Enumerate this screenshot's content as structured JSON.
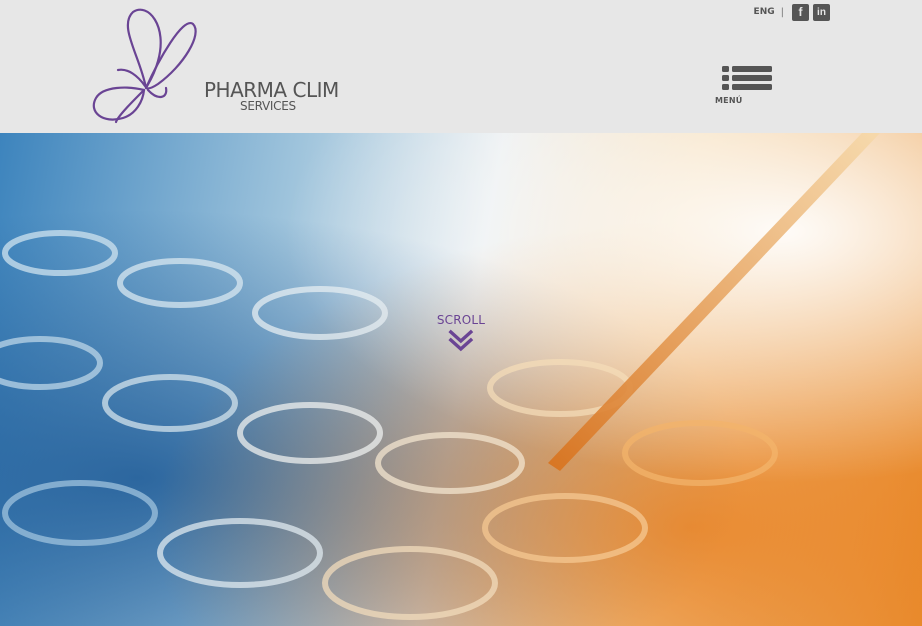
{
  "header": {
    "brand_name": "PHARMA CLIM",
    "brand_sub": "SERVICES",
    "language": "ENG",
    "separator": "|",
    "social": {
      "facebook": "f",
      "linkedin": "in"
    },
    "menu_label": "MENÚ"
  },
  "hero": {
    "scroll_label": "SCROLL"
  },
  "colors": {
    "header_bg": "#e7e7e7",
    "brand_text": "#555555",
    "accent_purple": "#6a4494"
  },
  "icons": [
    "butterfly-logo-icon",
    "facebook-icon",
    "linkedin-icon",
    "menu-list-icon",
    "double-chevron-down-icon"
  ]
}
